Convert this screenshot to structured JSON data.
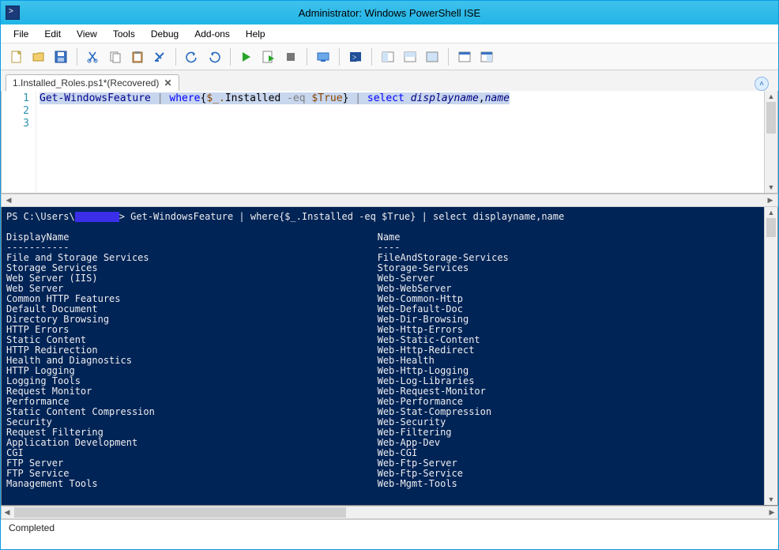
{
  "window": {
    "title": "Administrator: Windows PowerShell ISE"
  },
  "menu": {
    "file": "File",
    "edit": "Edit",
    "view": "View",
    "tools": "Tools",
    "debug": "Debug",
    "addons": "Add-ons",
    "help": "Help"
  },
  "tab": {
    "label": "1.Installed_Roles.ps1*(Recovered)"
  },
  "editor": {
    "line_numbers": [
      "1",
      "2",
      "3"
    ],
    "cmd1": "Get-WindowsFeature",
    "pipe": " | ",
    "where": "where",
    "brace_l": "{",
    "var": "$_.",
    "prop": "Installed",
    "op": " -eq ",
    "val": "$True",
    "brace_r": "}",
    "select": "select",
    "args": "displayname",
    "comma": ",",
    "arg2": "name"
  },
  "console": {
    "prompt_prefix": "PS C:\\Users\\",
    "prompt_cmd": "> Get-WindowsFeature | where{$_.Installed -eq $True} | select displayname,name",
    "hdr_display": "DisplayName",
    "hdr_name": "Name",
    "dash_display": "-----------",
    "dash_name": "----",
    "rows": [
      {
        "d": "File and Storage Services",
        "n": "FileAndStorage-Services"
      },
      {
        "d": "Storage Services",
        "n": "Storage-Services"
      },
      {
        "d": "Web Server (IIS)",
        "n": "Web-Server"
      },
      {
        "d": "Web Server",
        "n": "Web-WebServer"
      },
      {
        "d": "Common HTTP Features",
        "n": "Web-Common-Http"
      },
      {
        "d": "Default Document",
        "n": "Web-Default-Doc"
      },
      {
        "d": "Directory Browsing",
        "n": "Web-Dir-Browsing"
      },
      {
        "d": "HTTP Errors",
        "n": "Web-Http-Errors"
      },
      {
        "d": "Static Content",
        "n": "Web-Static-Content"
      },
      {
        "d": "HTTP Redirection",
        "n": "Web-Http-Redirect"
      },
      {
        "d": "Health and Diagnostics",
        "n": "Web-Health"
      },
      {
        "d": "HTTP Logging",
        "n": "Web-Http-Logging"
      },
      {
        "d": "Logging Tools",
        "n": "Web-Log-Libraries"
      },
      {
        "d": "Request Monitor",
        "n": "Web-Request-Monitor"
      },
      {
        "d": "Performance",
        "n": "Web-Performance"
      },
      {
        "d": "Static Content Compression",
        "n": "Web-Stat-Compression"
      },
      {
        "d": "Security",
        "n": "Web-Security"
      },
      {
        "d": "Request Filtering",
        "n": "Web-Filtering"
      },
      {
        "d": "Application Development",
        "n": "Web-App-Dev"
      },
      {
        "d": "CGI",
        "n": "Web-CGI"
      },
      {
        "d": "FTP Server",
        "n": "Web-Ftp-Server"
      },
      {
        "d": "FTP Service",
        "n": "Web-Ftp-Service"
      },
      {
        "d": "Management Tools",
        "n": "Web-Mgmt-Tools"
      }
    ]
  },
  "status": {
    "text": "Completed"
  }
}
